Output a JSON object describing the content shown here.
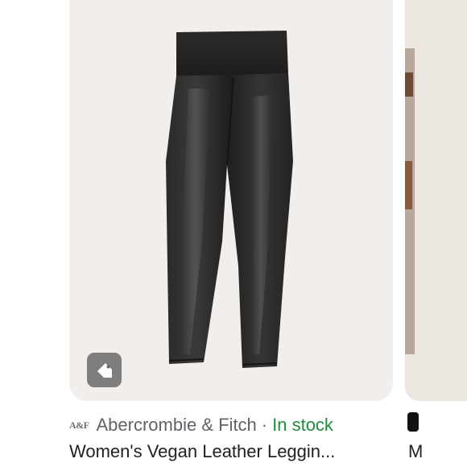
{
  "result": {
    "source_logo_text": "A&F",
    "source_name": "Abercrombie & Fitch",
    "separator": "·",
    "availability": "In stock",
    "title": "Women's Vegan Leather Leggin..."
  },
  "colors": {
    "availability": "#1e8e3e",
    "source": "#5f6368",
    "title": "#202124",
    "tile_background": "#f1eeec"
  },
  "icons": {
    "tag_button": "price-tag-icon"
  },
  "next_result": {
    "title_fragment": "M"
  }
}
